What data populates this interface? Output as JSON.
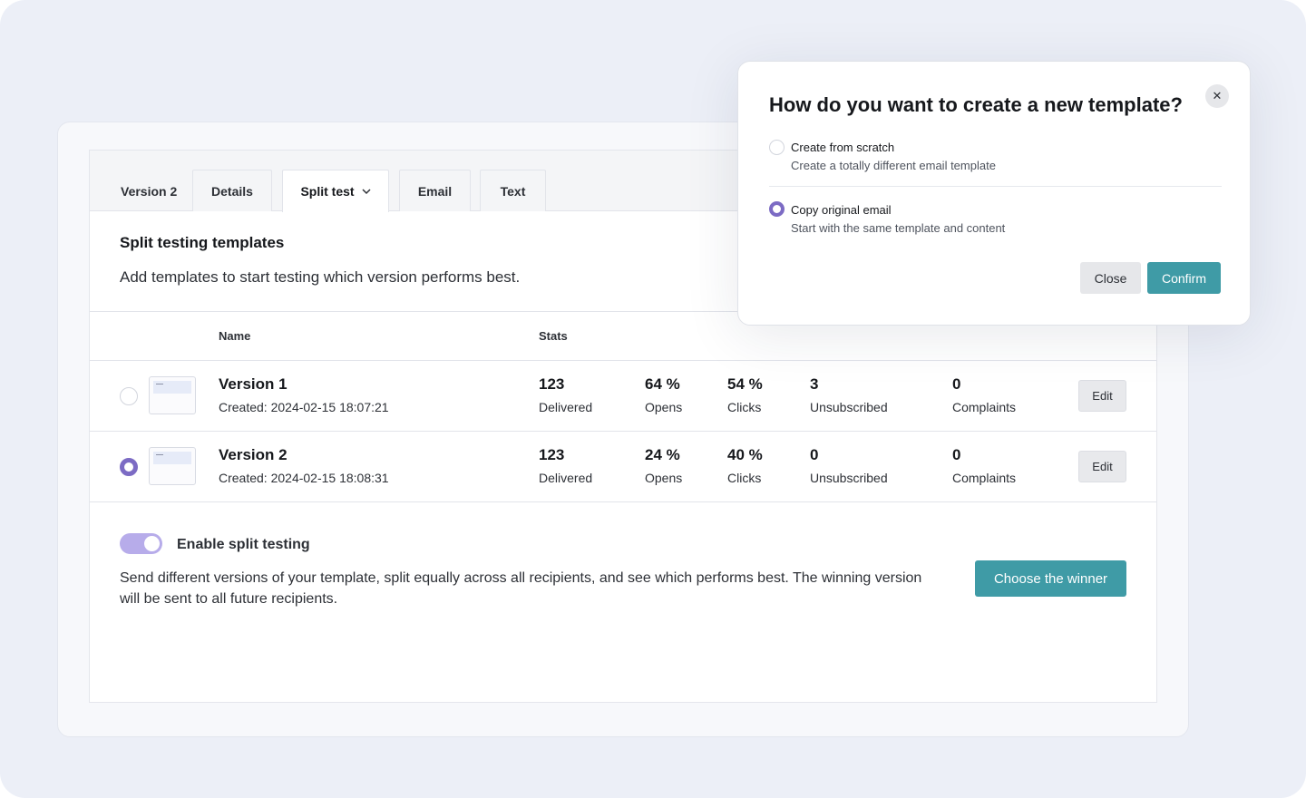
{
  "tabs": [
    {
      "label": "Version 2"
    },
    {
      "label": "Details"
    },
    {
      "label": "Split test",
      "icon": "chevron-down-icon",
      "active": true
    },
    {
      "label": "Email"
    },
    {
      "label": "Text"
    }
  ],
  "section": {
    "title": "Split testing templates",
    "subtitle": "Add templates to start testing which version performs best."
  },
  "table": {
    "headers": {
      "name": "Name",
      "stats": "Stats"
    },
    "rows": [
      {
        "selected": false,
        "name": "Version 1",
        "created": "Created: 2024-02-15 18:07:21",
        "stats": [
          {
            "value": "123",
            "label": "Delivered"
          },
          {
            "value": "64 %",
            "label": "Opens"
          },
          {
            "value": "54 %",
            "label": "Clicks"
          },
          {
            "value": "3",
            "label": "Unsubscribed"
          },
          {
            "value": "0",
            "label": "Complaints"
          }
        ],
        "edit_label": "Edit"
      },
      {
        "selected": true,
        "name": "Version 2",
        "created": "Created: 2024-02-15 18:08:31",
        "stats": [
          {
            "value": "123",
            "label": "Delivered"
          },
          {
            "value": "24 %",
            "label": "Opens"
          },
          {
            "value": "40 %",
            "label": "Clicks"
          },
          {
            "value": "0",
            "label": "Unsubscribed"
          },
          {
            "value": "0",
            "label": "Complaints"
          }
        ],
        "edit_label": "Edit"
      }
    ]
  },
  "split_testing": {
    "enabled": true,
    "toggle_label": "Enable split testing",
    "description": "Send different versions of your template, split equally across all recipients, and see which performs best. The winning version will be sent to all future recipients.",
    "winner_button": "Choose the winner"
  },
  "modal": {
    "title": "How do you want to create a new template?",
    "close_icon": "close-icon",
    "options": [
      {
        "title": "Create from scratch",
        "subtitle": "Create a totally different email template",
        "selected": false
      },
      {
        "title": "Copy original email",
        "subtitle": "Start with the same template and content",
        "selected": true
      }
    ],
    "close_button": "Close",
    "confirm_button": "Confirm"
  },
  "colors": {
    "accent_teal": "#3f9ba6",
    "radio_purple": "#7c6bc4",
    "toggle_purple": "#b7acea",
    "background": "#eceff7"
  }
}
